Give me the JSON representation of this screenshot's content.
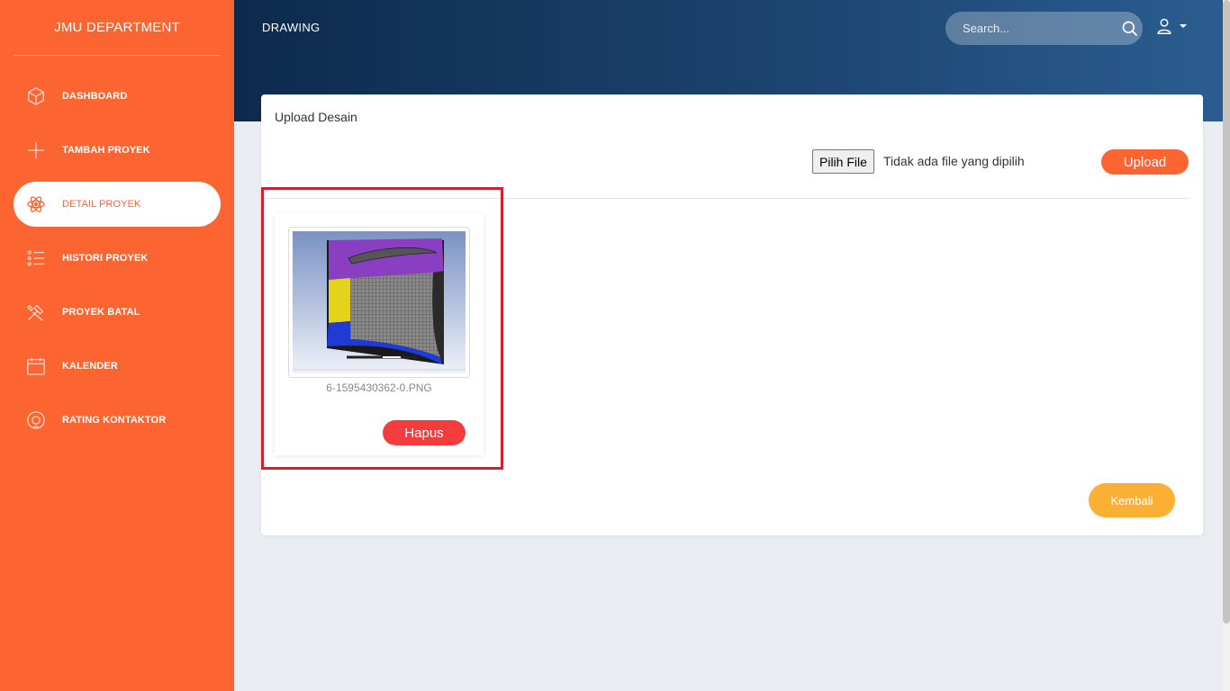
{
  "app": {
    "brand": "JMU DEPARTMENT"
  },
  "colors": {
    "sidebar": "#fc6432",
    "header_start": "#0d2a4c",
    "header_end": "#2b5d90",
    "upload": "#fc6432",
    "delete": "#f53c3c",
    "back": "#fbb034",
    "highlight": "#d81e2d"
  },
  "sidebar": {
    "items": [
      {
        "label": "DASHBOARD",
        "icon": "cube-icon",
        "active": false
      },
      {
        "label": "TAMBAH PROYEK",
        "icon": "plus-icon",
        "active": false
      },
      {
        "label": "DETAIL PROYEK",
        "icon": "atom-icon",
        "active": true
      },
      {
        "label": "HISTORI PROYEK",
        "icon": "list-icon",
        "active": false
      },
      {
        "label": "PROYEK BATAL",
        "icon": "tools-icon",
        "active": false
      },
      {
        "label": "KALENDER",
        "icon": "calendar-icon",
        "active": false
      },
      {
        "label": "RATING KONTAKTOR",
        "icon": "badge-icon",
        "active": false
      }
    ]
  },
  "header": {
    "title": "DRAWING",
    "search": {
      "placeholder": "Search..."
    },
    "user_icon": "user-icon"
  },
  "card": {
    "title": "Upload Desain",
    "file_input": {
      "button_label": "Pilih File",
      "status": "Tidak ada file yang dipilih"
    },
    "upload_label": "Upload",
    "files": [
      {
        "name": "6-1595430362-0.PNG",
        "delete_label": "Hapus"
      }
    ],
    "back_label": "Kembali"
  }
}
